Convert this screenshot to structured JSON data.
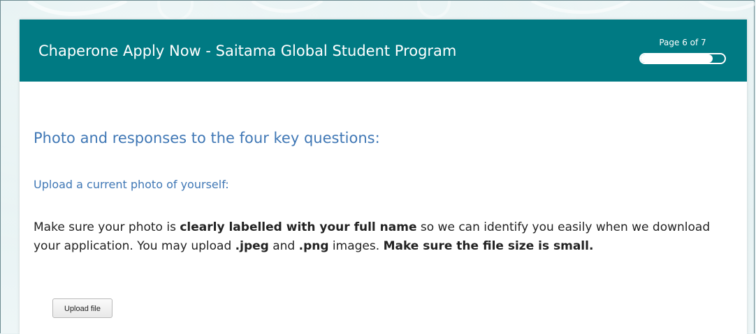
{
  "form": {
    "title": "Chaperone Apply Now - Saitama Global Student Program",
    "progress": {
      "label": "Page 6 of 7",
      "current_page": 6,
      "total_pages": 7
    }
  },
  "section": {
    "title": "Photo and responses to the four key questions:",
    "subsection_title": "Upload a current photo of yourself:",
    "instructions": {
      "part1": "Make sure your photo is ",
      "bold1": "clearly labelled with your full name",
      "part2": " so we can identify you easily when we download your application. You may upload ",
      "bold2": ".jpeg",
      "part3": " and ",
      "bold3": ".png",
      "part4": " images. ",
      "bold4": "Make sure the file size is small."
    },
    "upload_button_label": "Upload file"
  },
  "colors": {
    "header_bg": "#007a83",
    "heading_blue": "#3f77b5"
  }
}
